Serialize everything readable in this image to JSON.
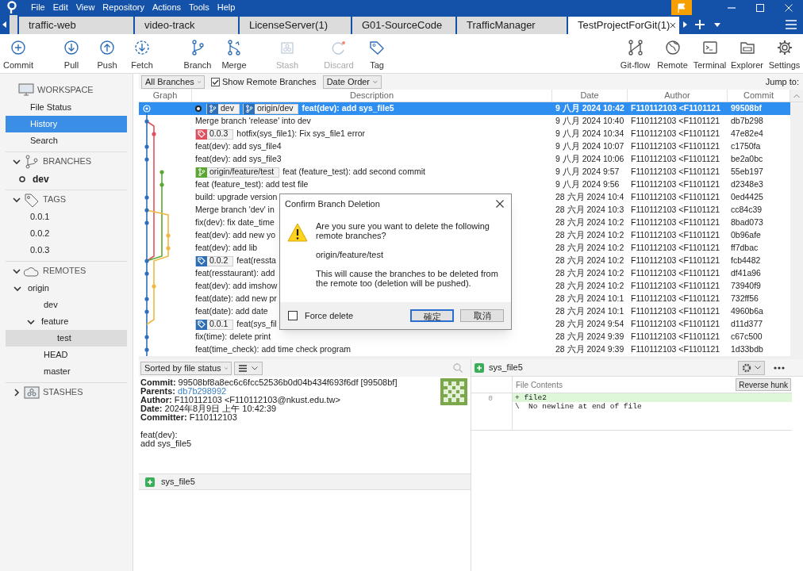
{
  "menu": [
    "File",
    "Edit",
    "View",
    "Repository",
    "Actions",
    "Tools",
    "Help"
  ],
  "tabs": [
    {
      "label": "traffic-web",
      "selected": false
    },
    {
      "label": "video-track",
      "selected": false
    },
    {
      "label": "LicenseServer(1)",
      "selected": false
    },
    {
      "label": "G01-SourceCode",
      "selected": false
    },
    {
      "label": "TrafficManager",
      "selected": false
    },
    {
      "label": "TestProjectForGit(1)",
      "selected": true
    }
  ],
  "toolbar": [
    {
      "kind": "commit",
      "label": "Commit",
      "disabled": false
    },
    {
      "kind": "pull",
      "label": "Pull",
      "disabled": false
    },
    {
      "kind": "push",
      "label": "Push",
      "disabled": false
    },
    {
      "kind": "fetch",
      "label": "Fetch",
      "disabled": false
    },
    {
      "kind": "branch",
      "label": "Branch",
      "disabled": false
    },
    {
      "kind": "merge",
      "label": "Merge",
      "disabled": false
    },
    {
      "kind": "stash",
      "label": "Stash",
      "disabled": true
    },
    {
      "kind": "discard",
      "label": "Discard",
      "disabled": true
    },
    {
      "kind": "tag",
      "label": "Tag",
      "disabled": false
    }
  ],
  "toolbar_right": [
    {
      "kind": "gitflow",
      "label": "Git-flow"
    },
    {
      "kind": "remote",
      "label": "Remote"
    },
    {
      "kind": "terminal",
      "label": "Terminal"
    },
    {
      "kind": "explorer",
      "label": "Explorer"
    },
    {
      "kind": "settings",
      "label": "Settings"
    }
  ],
  "sidebar": [
    {
      "kind": "workspace",
      "label": "WORKSPACE",
      "children": [
        {
          "label": "File Status",
          "selected": false
        },
        {
          "label": "History",
          "selected": true
        },
        {
          "label": "Search",
          "selected": false
        }
      ]
    },
    {
      "kind": "branches",
      "label": "BRANCHES",
      "expanded": true,
      "children": [
        {
          "label": "dev",
          "selected": false,
          "current": true
        }
      ]
    },
    {
      "kind": "tags",
      "label": "TAGS",
      "expanded": true,
      "children": [
        {
          "label": "0.0.1",
          "selected": false
        },
        {
          "label": "0.0.2",
          "selected": false
        },
        {
          "label": "0.0.3",
          "selected": false
        }
      ]
    },
    {
      "kind": "remotes",
      "label": "REMOTES",
      "expanded": true,
      "children": [
        {
          "label": "origin",
          "selected": false,
          "expanded": true,
          "children": [
            {
              "label": "dev",
              "selected": false
            },
            {
              "label": "feature",
              "selected": false,
              "expanded": true,
              "children": [
                {
                  "label": "test",
                  "selected": true
                }
              ]
            },
            {
              "label": "HEAD",
              "selected": false
            },
            {
              "label": "master",
              "selected": false
            }
          ]
        }
      ]
    },
    {
      "kind": "stashes",
      "label": "STASHES",
      "expanded": false
    }
  ],
  "filter": {
    "branches": "All Branches",
    "show_remote": {
      "label": "Show Remote Branches",
      "checked": true
    },
    "order": "Date Order",
    "jump": "Jump to:"
  },
  "columns": [
    "Graph",
    "Description",
    "Date",
    "Author",
    "Commit"
  ],
  "rows": [
    {
      "refs": [
        {
          "kind": "branch",
          "label": "dev",
          "color": "#2e6fb8",
          "current": true
        },
        {
          "kind": "branch",
          "label": "origin/dev",
          "color": "#2e6fb8",
          "current": false
        }
      ],
      "description": "feat(dev): add sys_file5",
      "date": "9 八月 2024 10:42",
      "author": "F110112103 <F1101121",
      "commit": "99508bf",
      "selected": true
    },
    {
      "description": "Merge branch 'release' into dev",
      "date": "9 八月 2024 10:40",
      "author": "F110112103 <F1101121",
      "commit": "db7b298",
      "selected": false
    },
    {
      "refs": [
        {
          "kind": "tag",
          "label": "0.0.3",
          "color": "#e0505f",
          "current": false
        }
      ],
      "description": "hotfix(sys_file1): Fix sys_file1 error",
      "date": "9 八月 2024 10:34",
      "author": "F110112103 <F1101121",
      "commit": "47e82e4",
      "selected": false
    },
    {
      "description": "feat(dev): add sys_file4",
      "date": "9 八月 2024 10:07",
      "author": "F110112103 <F1101121",
      "commit": "c1750fa",
      "selected": false
    },
    {
      "description": "feat(dev): add sys_file3",
      "date": "9 八月 2024 10:06",
      "author": "F110112103 <F1101121",
      "commit": "be2a0bc",
      "selected": false
    },
    {
      "refs": [
        {
          "kind": "branch",
          "label": "origin/feature/test",
          "color": "#5aa832",
          "current": false
        }
      ],
      "description": "feat (feature_test): add second commit",
      "date": "9 八月 2024 9:57",
      "author": "F110112103 <F1101121",
      "commit": "55eb197",
      "selected": false
    },
    {
      "description": "feat (feature_test): add test file",
      "date": "9 八月 2024 9:56",
      "author": "F110112103 <F1101121",
      "commit": "d2348e3",
      "selected": false
    },
    {
      "description": "build: upgrade version",
      "date": "28 六月 2024 10:4",
      "author": "F110112103 <F1101121",
      "commit": "0ed4425",
      "selected": false
    },
    {
      "description": "Merge branch 'dev' in",
      "date": "28 六月 2024 10:3",
      "author": "F110112103 <F1101121",
      "commit": "cc84c39",
      "selected": false
    },
    {
      "description": "fix(dev): fix date_time",
      "date": "28 六月 2024 10:2",
      "author": "F110112103 <F1101121",
      "commit": "8bad073",
      "selected": false
    },
    {
      "description": "feat(dev): add new yo",
      "date": "28 六月 2024 10:2",
      "author": "F110112103 <F1101121",
      "commit": "0b96afe",
      "selected": false
    },
    {
      "description": "feat(dev): add lib",
      "date": "28 六月 2024 10:2",
      "author": "F110112103 <F1101121",
      "commit": "ff7dbac",
      "selected": false
    },
    {
      "refs": [
        {
          "kind": "tag",
          "label": "0.0.2",
          "color": "#2e6fb8",
          "current": false
        }
      ],
      "description": "feat(ressta",
      "date": "28 六月 2024 10:2",
      "author": "F110112103 <F1101121",
      "commit": "fcb4482",
      "selected": false
    },
    {
      "description": "feat(resstaurant): add",
      "date": "28 六月 2024 10:2",
      "author": "F110112103 <F1101121",
      "commit": "df41a96",
      "selected": false
    },
    {
      "description": "feat(dev): add imshow",
      "date": "28 六月 2024 10:2",
      "author": "F110112103 <F1101121",
      "commit": "73940f9",
      "selected": false
    },
    {
      "description": "feat(date): add new pr",
      "date": "28 六月 2024 10:1",
      "author": "F110112103 <F1101121",
      "commit": "732ff56",
      "selected": false
    },
    {
      "description": "feat(date): add date",
      "date": "28 六月 2024 10:1",
      "author": "F110112103 <F1101121",
      "commit": "4960b6a",
      "selected": false
    },
    {
      "refs": [
        {
          "kind": "tag",
          "label": "0.0.1",
          "color": "#2e6fb8",
          "current": false
        }
      ],
      "description": "feat(sys_fil",
      "date": "28 六月 2024 9:54",
      "author": "F110112103 <F1101121",
      "commit": "d11d377",
      "selected": false
    },
    {
      "description": "fix(time): delete print",
      "date": "28 六月 2024 9:39",
      "author": "F110112103 <F1101121",
      "commit": "c67c500",
      "selected": false
    },
    {
      "description": "feat(time_check): add time check program",
      "date": "28 六月 2024 9:39",
      "author": "F110112103 <F1101121",
      "commit": "1d33bdb",
      "selected": false
    }
  ],
  "dialog": {
    "title": "Confirm Branch Deletion",
    "message": "Are you sure you want to delete the following remote branches?",
    "branch": "origin/feature/test",
    "info": "This will cause the branches to be deleted from the remote too (deletion will be pushed).",
    "force": {
      "label": "Force delete",
      "checked": false
    },
    "buttons": [
      {
        "label": "確定",
        "default": true
      },
      {
        "label": "取消",
        "default": false
      }
    ]
  },
  "files_toolbar": {
    "sort": "Sorted by file status"
  },
  "details": [
    {
      "label": "Commit:",
      "value": "99508bf8a8ec6c6fcc52536b0d04b434f693f6df [99508bf]",
      "kind": "text"
    },
    {
      "label": "Parents:",
      "value": "db7b298992",
      "kind": "link"
    },
    {
      "label": "Author:",
      "value": "F110112103 <F110112103@nkust.edu.tw>",
      "kind": "text"
    },
    {
      "label": "Date:",
      "value": "2024年8月9日 上午 10:42:39",
      "kind": "text"
    },
    {
      "label": "Committer:",
      "value": "F110112103",
      "kind": "text"
    }
  ],
  "message": [
    "feat(dev):",
    "add sys_file5"
  ],
  "files": [
    {
      "name": "sys_file5"
    }
  ],
  "diff": {
    "file": "sys_file5",
    "header": "File Contents",
    "action": "Reverse hunk",
    "lines": [
      {
        "number": "0",
        "text": "+ file2",
        "kind": "added"
      },
      {
        "text": "\\  No newline at end of file",
        "kind": "context"
      }
    ]
  }
}
